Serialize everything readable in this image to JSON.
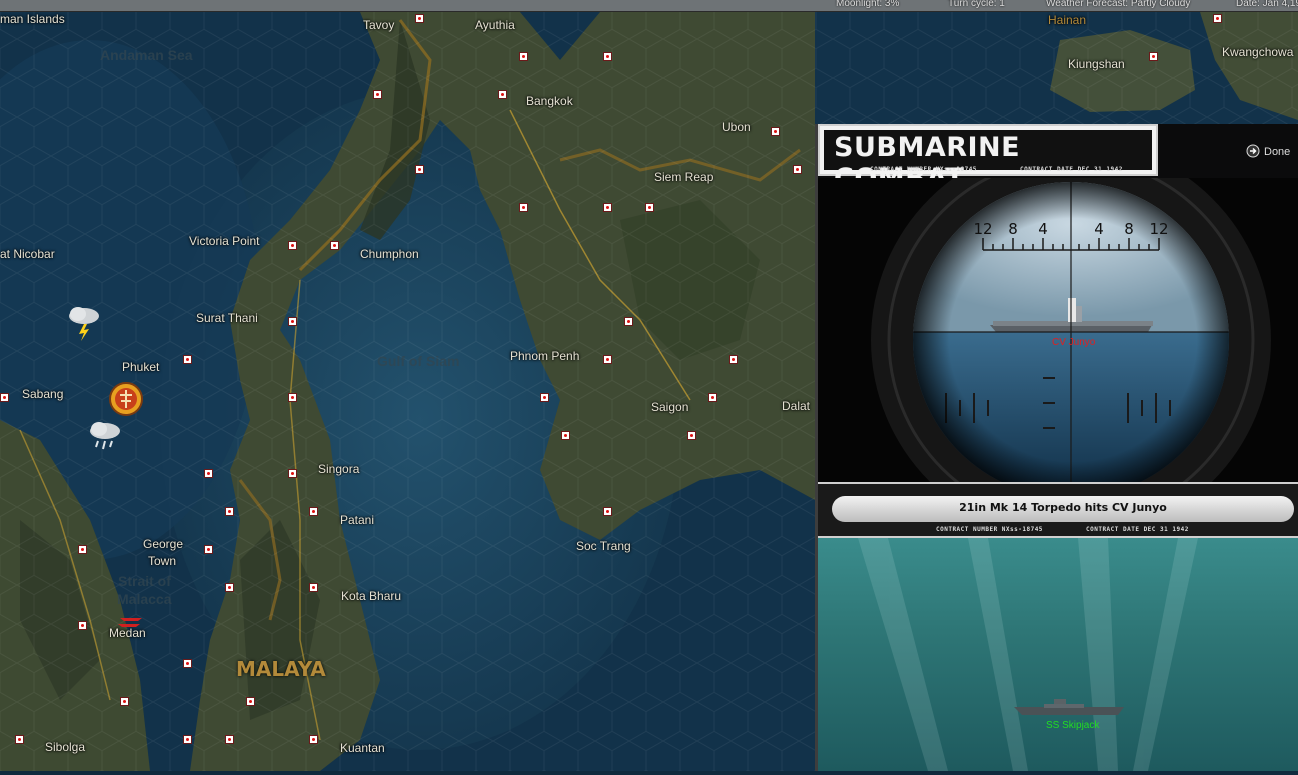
{
  "status_bar": {
    "moonlight": "Moonlight: 3%",
    "turn_cycle": "Turn cycle: 1",
    "weather_forecast": "Weather Forecast: Partly Cloudy",
    "date": "Date: Jan 4,19"
  },
  "map": {
    "places": [
      "man Islands",
      "Tavoy",
      "Ayuthia",
      "Hainan",
      "Kiungshan",
      "Kwangchowa",
      "Andaman Sea",
      "Bangkok",
      "Ubon",
      "Siem Reap",
      "at Nicobar",
      "Victoria Point",
      "Chumphon",
      "Surat Thani",
      "Phuket",
      "Phnom Penh",
      "Gulf of Siam",
      "Sabang",
      "Saigon",
      "Dalat",
      "Singora",
      "Patani",
      "George",
      "Town",
      "Soc Trang",
      "Strait of",
      "Malacca",
      "Medan",
      "Kota Bharu",
      "MALAYA",
      "Sibolga",
      "Kuantan"
    ],
    "sea_color": "#12324a",
    "land_color": "#3f4a33",
    "border_color": "#8a6a22",
    "base_marker_color": "#d11111"
  },
  "sub_combat": {
    "title": "SUBMARINE COMBAT",
    "contract_number": "CONTRACT NUMBER  NXss-18745",
    "contract_date": "CONTRACT DATE  DEC  31  1942",
    "done_label": "Done",
    "done_icon": "arrow-right-circle-icon",
    "scope_ticks": [
      "12",
      "8",
      "4",
      "4",
      "8",
      "12"
    ],
    "target_name": "CV Junyo",
    "target_color": "#e02020",
    "message": "21in Mk 14 Torpedo hits CV Junyo",
    "submarine_name": "SS Skipjack",
    "submarine_color": "#22dd22"
  }
}
